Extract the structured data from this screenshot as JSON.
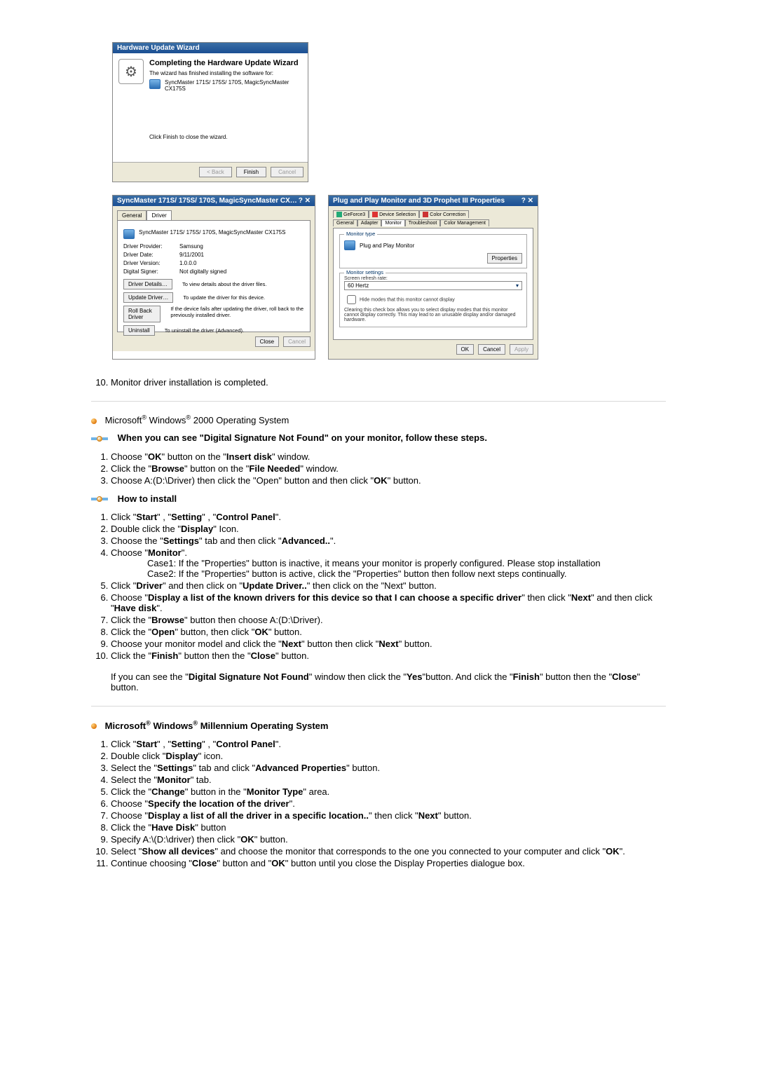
{
  "wizard": {
    "title": "Hardware Update Wizard",
    "heading": "Completing the Hardware Update Wizard",
    "body1": "The wizard has finished installing the software for:",
    "device": "SyncMaster 171S/ 175S/ 170S, MagicSyncMaster CX175S",
    "footnote": "Click Finish to close the wizard.",
    "back": "< Back",
    "finish": "Finish",
    "cancel": "Cancel"
  },
  "driverProps": {
    "title": "SyncMaster 171S/ 175S/ 170S, MagicSyncMaster CX…",
    "tabGeneral": "General",
    "tabDriver": "Driver",
    "device": "SyncMaster 171S/ 175S/ 170S, MagicSyncMaster CX175S",
    "providerLabel": "Driver Provider:",
    "providerValue": "Samsung",
    "dateLabel": "Driver Date:",
    "dateValue": "9/11/2001",
    "versionLabel": "Driver Version:",
    "versionValue": "1.0.0.0",
    "signerLabel": "Digital Signer:",
    "signerValue": "Not digitally signed",
    "details": "Driver Details…",
    "detailsDesc": "To view details about the driver files.",
    "update": "Update Driver…",
    "updateDesc": "To update the driver for this device.",
    "rollback": "Roll Back Driver",
    "rollbackDesc": "If the device fails after updating the driver, roll back to the previously installed driver.",
    "uninstall": "Uninstall",
    "uninstallDesc": "To uninstall the driver (Advanced).",
    "close": "Close",
    "cancel": "Cancel"
  },
  "monitorProps": {
    "title": "Plug and Play Monitor and 3D Prophet III Properties",
    "tabRow1": {
      "a": "GeForce3",
      "b": "Device Selection",
      "c": "Color Correction"
    },
    "tabRow2": {
      "a": "General",
      "b": "Adapter",
      "c": "Monitor",
      "d": "Troubleshoot",
      "e": "Color Management"
    },
    "monitorType": "Monitor type",
    "monitorName": "Plug and Play Monitor",
    "properties": "Properties",
    "monitorSettings": "Monitor settings",
    "refreshLabel": "Screen refresh rate:",
    "refreshValue": "60 Hertz",
    "hide": "Hide modes that this monitor cannot display",
    "warn": "Clearing this check box allows you to select display modes that this monitor cannot display correctly. This may lead to an unusable display and/or damaged hardware.",
    "ok": "OK",
    "cancel": "Cancel",
    "apply": "Apply"
  },
  "instr": {
    "step10": "Monitor driver installation is completed.",
    "win2000": "Microsoft® Windows® 2000 Operating System",
    "winME": "Microsoft® Windows® Millennium Operating System",
    "dsigHeading": "When you can see \"Digital Signature Not Found\" on your monitor, follow these steps.",
    "howto": "How to install"
  },
  "dsig": {
    "s1_a": "Choose \"",
    "s1_b": "OK",
    "s1_c": "\" button on the \"",
    "s1_d": "Insert disk",
    "s1_e": "\" window.",
    "s2_a": "Click the \"",
    "s2_b": "Browse",
    "s2_c": "\" button on the \"",
    "s2_d": "File Needed",
    "s2_e": "\" window.",
    "s3": "Choose A:(D:\\Driver) then click the \"Open\" button and then click \"",
    "s3_b": "OK",
    "s3_c": "\" button."
  },
  "install2000": {
    "s1a": "Click \"",
    "s1b": "Start",
    "s1c": "\" , \"",
    "s1d": "Setting",
    "s1e": "\" , \"",
    "s1f": "Control Panel",
    "s1g": "\".",
    "s2a": "Double click the \"",
    "s2b": "Display",
    "s2c": "\" Icon.",
    "s3a": "Choose the \"",
    "s3b": "Settings",
    "s3c": "\" tab and then click \"",
    "s3d": "Advanced..",
    "s3e": "\".",
    "s4a": "Choose \"",
    "s4b": "Monitor",
    "s4c": "\".",
    "case1": "Case1: If the \"Properties\" button is inactive, it means your monitor is properly configured. Please stop installation",
    "case2": "Case2: If the \"Properties\" button is active, click the \"Properties\" button then follow next steps continually.",
    "s5a": "Click \"",
    "s5b": "Driver",
    "s5c": "\" and then click on \"",
    "s5d": "Update Driver..",
    "s5e": "\" then click on the \"Next\" button.",
    "s6a": "Choose \"",
    "s6b": "Display a list of the known drivers for this device so that I can choose a specific driver",
    "s6c": "\" then click \"",
    "s6d": "Next",
    "s6e": "\" and then click \"",
    "s6f": "Have disk",
    "s6g": "\".",
    "s7a": "Click the \"",
    "s7b": "Browse",
    "s7c": "\" button then choose A:(D:\\Driver).",
    "s8a": "Click the \"",
    "s8b": "Open",
    "s8c": "\" button, then click \"",
    "s8d": "OK",
    "s8e": "\" button.",
    "s9a": "Choose your monitor model and click the \"",
    "s9b": "Next",
    "s9c": "\" button then click \"",
    "s9d": "Next",
    "s9e": "\" button.",
    "s10a": "Click the \"",
    "s10b": "Finish",
    "s10c": "\" button then the \"",
    "s10d": "Close",
    "s10e": "\" button.",
    "post1a": "If you can see the \"",
    "post1b": "Digital Signature Not Found",
    "post1c": "\" window then click the \"",
    "post1d": "Yes",
    "post1e": "\"button. And click the \"",
    "post1f": "Finish",
    "post1g": "\" button then the \"",
    "post1h": "Close",
    "post1i": "\" button."
  },
  "installME": {
    "s1a": "Click \"",
    "s1b": "Start",
    "s1c": "\" , \"",
    "s1d": "Setting",
    "s1e": "\" , \"",
    "s1f": "Control Panel",
    "s1g": "\".",
    "s2a": "Double click \"",
    "s2b": "Display",
    "s2c": "\" icon.",
    "s3a": "Select the \"",
    "s3b": "Settings",
    "s3c": "\" tab and click \"",
    "s3d": "Advanced Properties",
    "s3e": "\" button.",
    "s4a": "Select the \"",
    "s4b": "Monitor",
    "s4c": "\" tab.",
    "s5a": "Click the \"",
    "s5b": "Change",
    "s5c": "\" button in the \"",
    "s5d": "Monitor Type",
    "s5e": "\" area.",
    "s6a": "Choose \"",
    "s6b": "Specify the location of the driver",
    "s6c": "\".",
    "s7a": "Choose \"",
    "s7b": "Display a list of all the driver in a specific location..",
    "s7c": "\" then click \"",
    "s7d": "Next",
    "s7e": "\" button.",
    "s8a": "Click the \"",
    "s8b": "Have Disk",
    "s8c": "\" button",
    "s9a": "Specify A:\\(D:\\driver) then click \"",
    "s9b": "OK",
    "s9c": "\" button.",
    "s10a": "Select \"",
    "s10b": "Show all devices",
    "s10c": "\" and choose the monitor that corresponds to the one you connected to your computer and click \"",
    "s10d": "OK",
    "s10e": "\".",
    "s11a": "Continue choosing \"",
    "s11b": "Close",
    "s11c": "\" button and \"",
    "s11d": "OK",
    "s11e": "\" button until you close the Display Properties dialogue box."
  }
}
